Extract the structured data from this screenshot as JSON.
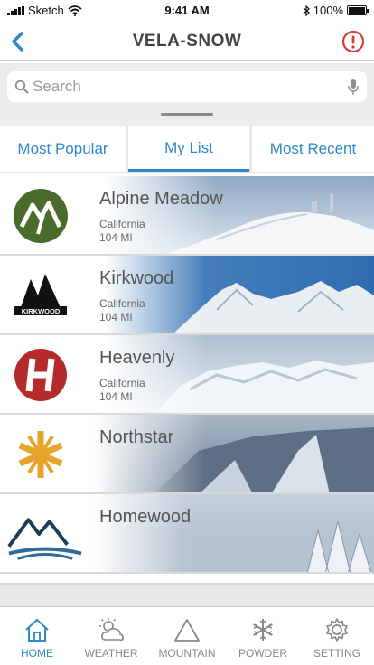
{
  "status_bar": {
    "carrier": "Sketch",
    "time": "9:41 AM",
    "battery": "100%",
    "battery_level": 1.0
  },
  "nav": {
    "title": "VELA-SNOW",
    "back_icon": "chevron-left-icon",
    "alert_icon": "alert-icon"
  },
  "search": {
    "placeholder": "Search",
    "value": ""
  },
  "tabs": [
    {
      "label": "Most Popular",
      "selected": false
    },
    {
      "label": "My List",
      "selected": true
    },
    {
      "label": "Most Recent",
      "selected": false
    }
  ],
  "resorts": [
    {
      "name": "Alpine Meadow",
      "state": "California",
      "distance": "104 MI",
      "logo": "alpine-meadows-logo"
    },
    {
      "name": "Kirkwood",
      "state": "California",
      "distance": "104 MI",
      "logo": "kirkwood-logo",
      "logo_text": "KIRKWOOD"
    },
    {
      "name": "Heavenly",
      "state": "California",
      "distance": "104 MI",
      "logo": "heavenly-logo"
    },
    {
      "name": "Northstar",
      "state": "",
      "distance": "",
      "logo": "northstar-logo"
    },
    {
      "name": "Homewood",
      "state": "",
      "distance": "",
      "logo": "homewood-logo"
    }
  ],
  "tab_bar": [
    {
      "label": "HOME",
      "icon": "home-icon",
      "active": true
    },
    {
      "label": "WEATHER",
      "icon": "weather-icon",
      "active": false
    },
    {
      "label": "MOUNTAIN",
      "icon": "mountain-icon",
      "active": false
    },
    {
      "label": "POWDER",
      "icon": "snowflake-icon",
      "active": false
    },
    {
      "label": "SETTING",
      "icon": "gear-icon",
      "active": false
    }
  ],
  "colors": {
    "accent": "#2e88c9",
    "alert": "#d93b3b",
    "alpine_green": "#4a6b2a",
    "heavenly_red": "#b52a2a",
    "northstar_gold": "#e6a52a",
    "homewood_navy": "#1f3b5c"
  }
}
